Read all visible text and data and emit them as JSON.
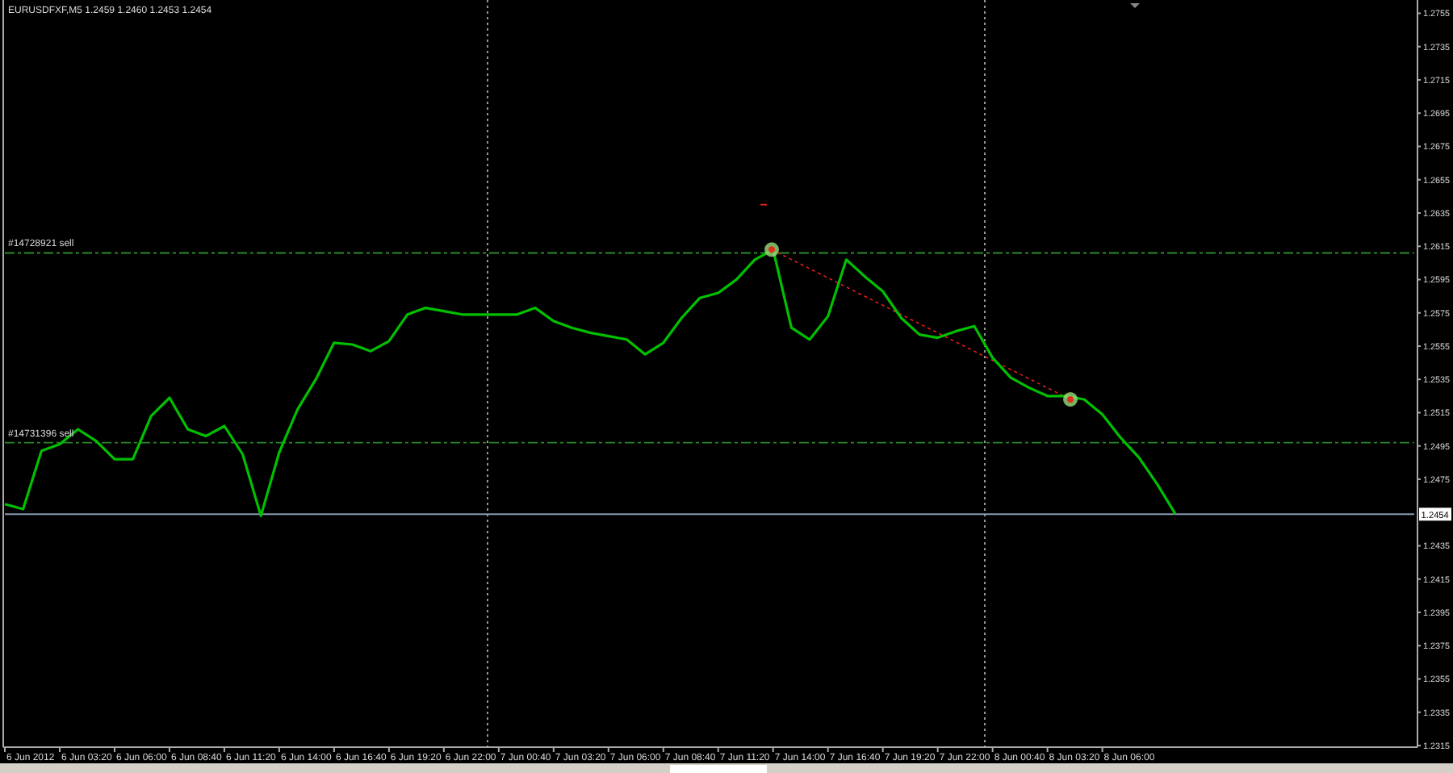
{
  "window": {
    "title": "EURUSDFXF,M5  1.2459 1.2460 1.2453 1.2454"
  },
  "chart": {
    "chart_data": {
      "type": "line",
      "ylim": [
        1.2314,
        1.2763
      ],
      "categories": [
        null,
        "6 Jun 2012",
        null,
        null,
        "6 Jun 03:20",
        null,
        null,
        "6 Jun 06:00",
        null,
        null,
        "6 Jun 08:40",
        null,
        null,
        "6 Jun 11:20",
        null,
        null,
        "6 Jun 14:00",
        null,
        null,
        "6 Jun 16:40",
        null,
        null,
        "6 Jun 19:20",
        null,
        null,
        "6 Jun 22:00",
        null,
        null,
        "7 Jun 00:40",
        null,
        null,
        "7 Jun 03:20",
        null,
        null,
        "7 Jun 06:00",
        null,
        null,
        "7 Jun 08:40",
        null,
        null,
        "7 Jun 11:20",
        null,
        null,
        "7 Jun 14:00",
        null,
        null,
        "7 Jun 16:40",
        null,
        null,
        "7 Jun 19:20",
        null,
        null,
        "7 Jun 22:00",
        null,
        null,
        "8 Jun 00:40",
        null,
        null,
        "8 Jun 03:20",
        null,
        null,
        "8 Jun 06:00",
        null,
        null,
        null
      ],
      "series": [
        {
          "color": "#00c000",
          "values": [
            1.246,
            1.2457,
            1.2492,
            1.2496,
            1.2505,
            1.2498,
            1.2487,
            1.2487,
            1.2513,
            1.2524,
            1.2505,
            1.2501,
            1.2507,
            1.249,
            1.2453,
            1.2491,
            1.2517,
            1.2535,
            1.2557,
            1.2556,
            1.2552,
            1.2558,
            1.2574,
            1.2578,
            1.2576,
            1.2574,
            1.2574,
            1.2574,
            1.2574,
            1.2578,
            1.257,
            1.2566,
            1.2563,
            1.2561,
            1.2559,
            1.255,
            1.2557,
            1.2572,
            1.2584,
            1.2587,
            1.2595,
            1.2607,
            1.2613,
            1.2566,
            1.2559,
            1.2573,
            1.2607,
            1.2597,
            1.2588,
            1.2572,
            1.2562,
            1.256,
            1.2564,
            1.2567,
            1.2548,
            1.2536,
            1.253,
            1.2525,
            1.2525,
            1.2523,
            1.2514,
            1.25,
            1.2488,
            1.2472,
            1.2454
          ]
        }
      ],
      "yticks": [
        1.2755,
        1.2735,
        1.2715,
        1.2695,
        1.2675,
        1.2655,
        1.2635,
        1.2615,
        1.2595,
        1.2575,
        1.2555,
        1.2535,
        1.2515,
        1.2495,
        1.2475,
        1.2435,
        1.2415,
        1.2395,
        1.2375,
        1.2355,
        1.2335,
        1.2315
      ],
      "ref_lines": [
        {
          "axis": "y",
          "value": 1.2611,
          "label": "#14728921 sell",
          "color": "#2a8a2a"
        },
        {
          "axis": "y",
          "value": 1.2497,
          "label": "#14731396 sell",
          "color": "#2a8a2a"
        },
        {
          "axis": "y",
          "value": 1.2454,
          "label": "1.2454",
          "color": "#8898b0"
        }
      ]
    }
  }
}
